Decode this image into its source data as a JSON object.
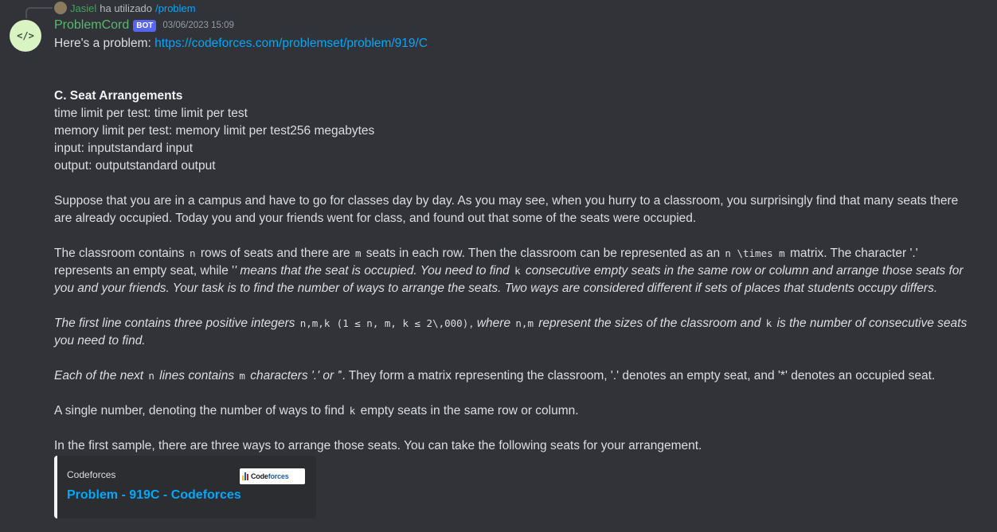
{
  "reply": {
    "user": "Jasiel",
    "action": "ha utilizado",
    "command": "/problem"
  },
  "message": {
    "author": "ProblemCord",
    "badge": "BOT",
    "timestamp": "03/06/2023 15:09",
    "intro": "Here's a problem: ",
    "link": "https://codeforces.com/problemset/problem/919/C",
    "title": "C. Seat Arrangements",
    "meta": [
      "time limit per test: time limit per test",
      "memory limit per test: memory limit per test256 megabytes",
      "input: inputstandard input",
      "output: outputstandard output"
    ],
    "para1": "Suppose that you are in a campus and have to go for classes day by day. As you may see, when you hurry to a classroom, you surprisingly find that many seats there are already occupied. Today you and your friends went for class, and found out that some of the seats were occupied.",
    "para2": {
      "t1": "The classroom contains ",
      "c1": "n",
      "t2": " rows of seats and there are ",
      "c2": "m",
      "t3": " seats in each row. Then the classroom can be represented as an ",
      "c3": "n \\times m",
      "t4": " matrix. The character '.' represents an empty seat, while '",
      "t5": "' means that the seat is occupied. You need to find ",
      "c4": "k",
      "t6": " consecutive empty seats in the same row or column and arrange those seats for you and your friends. Your task is to find the number of ways to arrange the seats. Two ways are considered different if sets of places that students occupy differs."
    },
    "para3": {
      "t1": "The first line contains three positive integers ",
      "c1": "n,m,k",
      "c2": "(1 ≤ n, m, k ≤ 2\\,000)",
      "t2": ", where ",
      "c3": "n,m",
      "t3": " represent the sizes of the classroom and ",
      "c4": "k",
      "t4": " is the number of consecutive seats you need to find."
    },
    "para4": {
      "t1": "Each of the next ",
      "c1": "n",
      "t2": " lines contains ",
      "c2": "m",
      "t3": " characters '.' or '",
      "t4": "'. They form a matrix representing the classroom, '.' denotes an empty seat, and '*' denotes an occupied seat."
    },
    "para5": {
      "t1": "A single number, denoting the number of ways to find ",
      "c1": "k",
      "t2": " empty seats in the same row or column."
    },
    "para6": "In the first sample, there are three ways to arrange those seats. You can take the following seats for your arrangement."
  },
  "embed": {
    "provider": "Codeforces",
    "title": "Problem - 919C - Codeforces",
    "thumb_text_a": "Code",
    "thumb_text_b": "forces",
    "border_color": "#f2f3f5"
  },
  "colors": {
    "background": "#313338",
    "username": "#57b86e",
    "link": "#00a8fc",
    "bot_badge": "#5865f2"
  }
}
